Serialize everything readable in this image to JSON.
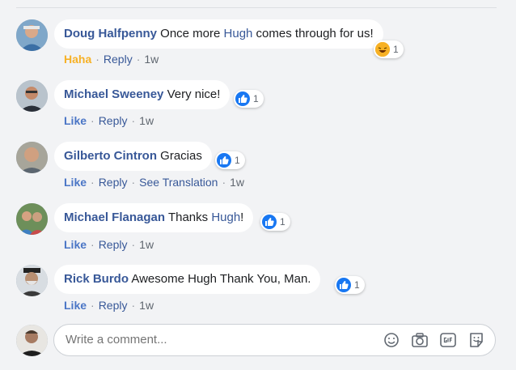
{
  "comments": [
    {
      "author": "Doug Halfpenny",
      "text_before": " Once more ",
      "mention": "Hugh",
      "text_after": " comes through for us!",
      "reaction_type": "haha",
      "reaction_count": "1",
      "action_primary": "Haha",
      "reply": "Reply",
      "time": "1w"
    },
    {
      "author": "Michael Sweeney",
      "text_before": " Very nice!",
      "mention": "",
      "text_after": "",
      "reaction_type": "like",
      "reaction_count": "1",
      "action_primary": "Like",
      "reply": "Reply",
      "time": "1w"
    },
    {
      "author": "Gilberto Cintron",
      "text_before": " Gracias",
      "mention": "",
      "text_after": "",
      "reaction_type": "like",
      "reaction_count": "1",
      "action_primary": "Like",
      "reply": "Reply",
      "translate": "See Translation",
      "time": "1w"
    },
    {
      "author": "Michael Flanagan",
      "text_before": " Thanks ",
      "mention": "Hugh",
      "text_after": "!",
      "reaction_type": "like",
      "reaction_count": "1",
      "action_primary": "Like",
      "reply": "Reply",
      "time": "1w"
    },
    {
      "author": "Rick Burdo",
      "text_before": " Awesome Hugh Thank You, Man.",
      "mention": "",
      "text_after": "",
      "reaction_type": "like",
      "reaction_count": "1",
      "action_primary": "Like",
      "reply": "Reply",
      "time": "1w"
    }
  ],
  "separator": "·",
  "composer": {
    "placeholder": "Write a comment..."
  },
  "icons": {
    "emoji": "emoji-icon",
    "camera": "camera-icon",
    "gif": "gif-icon",
    "sticker": "sticker-icon"
  },
  "colors": {
    "link": "#385898",
    "like": "#1877f2",
    "haha": "#f7b125",
    "muted": "#606770"
  }
}
